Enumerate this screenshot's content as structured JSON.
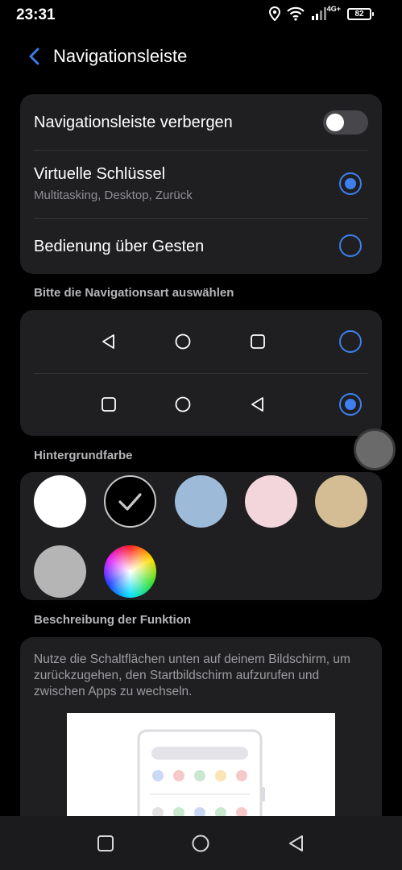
{
  "status_bar": {
    "time": "23:31",
    "network": "4G+",
    "battery": "82",
    "icons": [
      "location-icon",
      "wifi-icon",
      "signal-icon",
      "battery-icon"
    ]
  },
  "header": {
    "title": "Navigationsleiste",
    "back_icon": "chevron-left-icon"
  },
  "nav_options": {
    "hide_label": "Navigationsleiste verbergen",
    "hide_enabled": false,
    "virtual_keys_title": "Virtuelle Schlüssel",
    "virtual_keys_subtitle": "Multitasking, Desktop, Zurück",
    "virtual_keys_selected": true,
    "gestures_title": "Bedienung über Gesten",
    "gestures_selected": false
  },
  "layout_section": {
    "label": "Bitte die Navigationsart auswählen",
    "layouts": [
      {
        "order": [
          "back-icon",
          "home-icon",
          "recents-icon"
        ],
        "selected": false
      },
      {
        "order": [
          "recents-icon",
          "home-icon",
          "back-icon"
        ],
        "selected": true
      }
    ]
  },
  "color_section": {
    "label": "Hintergrundfarbe",
    "colors": [
      "#ffffff",
      "#000000",
      "#9dbbd9",
      "#f3d6dc",
      "#d4bd94",
      "#b5b5b5",
      "color-wheel"
    ],
    "selected_index": 1
  },
  "description": {
    "label": "Beschreibung der Funktion",
    "text": "Nutze die Schaltflächen unten auf deinem Bildschirm, um zurückzugehen, den Startbildschirm aufzurufen und zwischen Apps zu wechseln."
  },
  "system_nav": {
    "buttons": [
      "recents-icon",
      "home-icon",
      "back-icon"
    ]
  },
  "colors": {
    "accent": "#3d7fee",
    "card": "#1f1f21",
    "background": "#000000"
  }
}
